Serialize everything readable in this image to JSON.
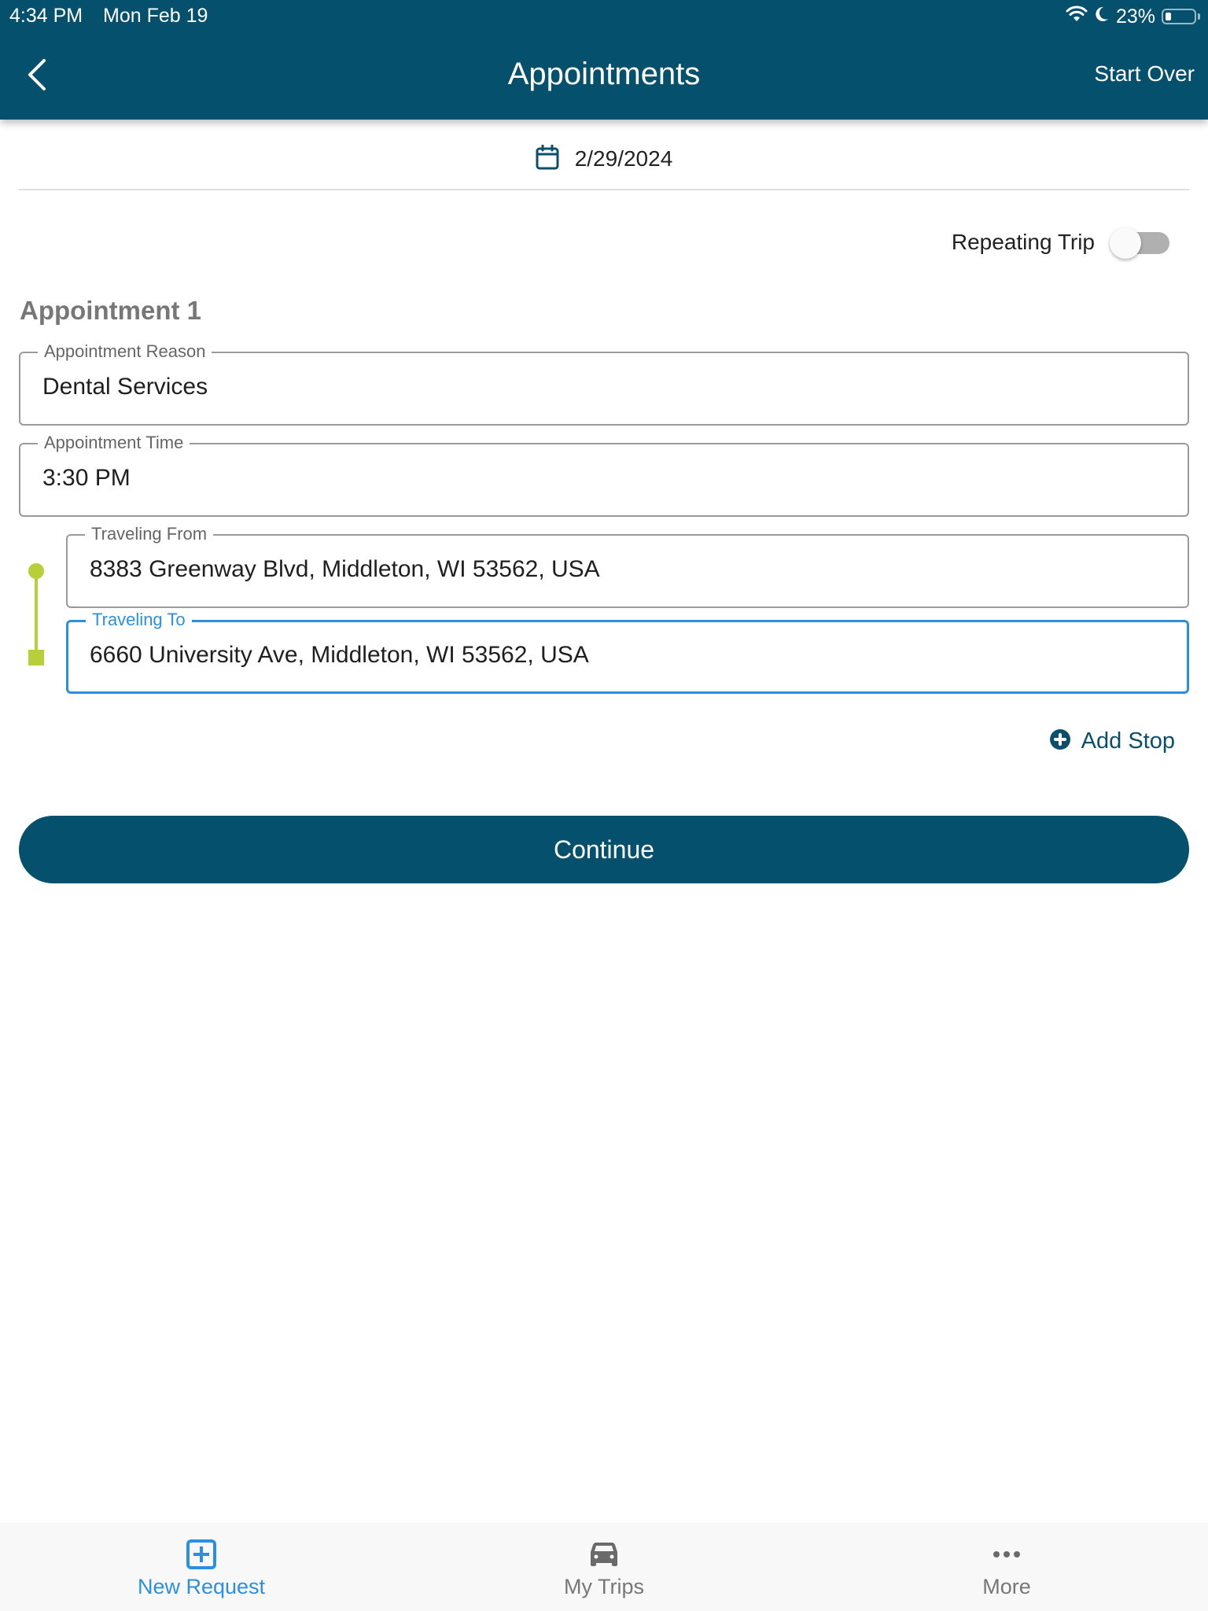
{
  "status_bar": {
    "time": "4:34 PM",
    "date": "Mon Feb 19",
    "battery_percent_label": "23%",
    "battery_level": 0.23,
    "icons": [
      "wifi-icon",
      "moon-icon",
      "battery-icon"
    ]
  },
  "header": {
    "back_icon": "chevron-left-icon",
    "title": "Appointments",
    "start_over_label": "Start Over"
  },
  "date_selector": {
    "icon": "calendar-icon",
    "value": "2/29/2024"
  },
  "repeating_trip": {
    "label": "Repeating Trip",
    "enabled": false
  },
  "appointment": {
    "title": "Appointment 1",
    "reason": {
      "label": "Appointment Reason",
      "value": "Dental Services"
    },
    "time": {
      "label": "Appointment Time",
      "value": "3:30 PM"
    },
    "from": {
      "label": "Traveling From",
      "value": "8383 Greenway Blvd, Middleton, WI 53562, USA"
    },
    "to": {
      "label": "Traveling To",
      "value": "6660 University Ave, Middleton, WI 53562, USA"
    }
  },
  "add_stop": {
    "icon": "plus-circle-icon",
    "label": "Add Stop"
  },
  "continue_label": "Continue",
  "tabbar": {
    "items": [
      {
        "label": "New Request",
        "icon": "plus-square-icon",
        "active": true
      },
      {
        "label": "My Trips",
        "icon": "car-icon",
        "active": false
      },
      {
        "label": "More",
        "icon": "more-dots-icon",
        "active": false
      }
    ]
  },
  "colors": {
    "brand": "#05506d",
    "accent_blue": "#2d8fe0",
    "route_green": "#b9cf3a"
  }
}
